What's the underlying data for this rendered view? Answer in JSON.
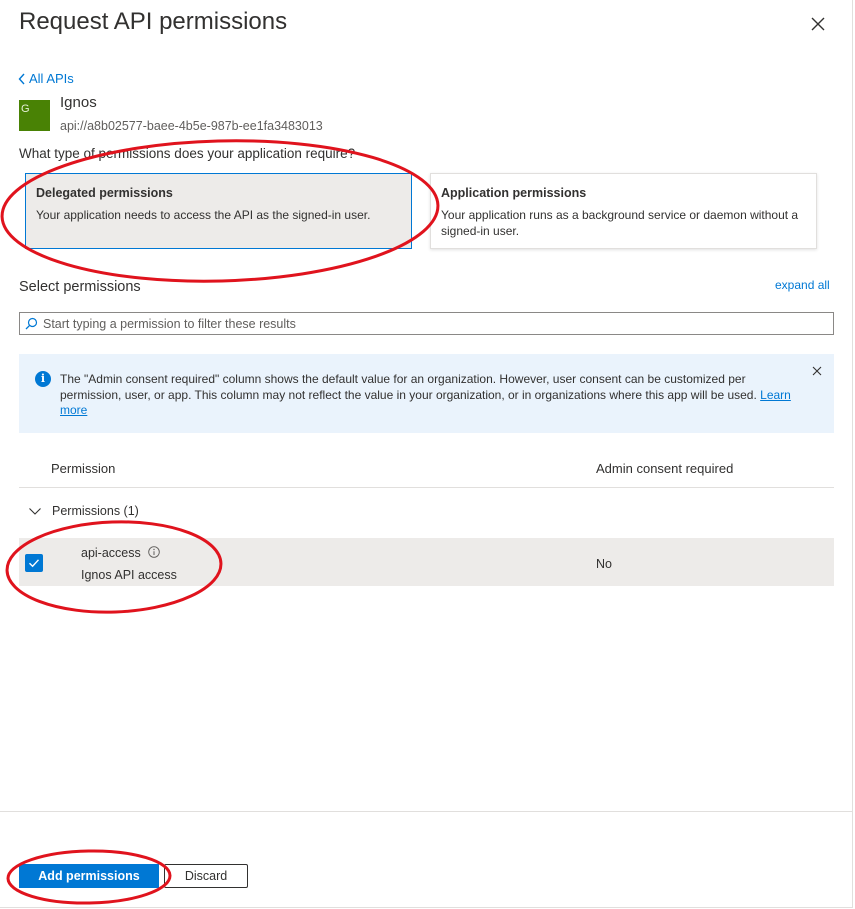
{
  "panel": {
    "title": "Request API permissions",
    "back_link": "All APIs"
  },
  "api": {
    "avatar_letter": "G",
    "avatar_color": "#498205",
    "name": "Ignos",
    "uri": "api://a8b02577-baee-4b5e-987b-ee1fa3483013"
  },
  "permission_types": {
    "question": "What type of permissions does your application require?",
    "delegated": {
      "title": "Delegated permissions",
      "description": "Your application needs to access the API as the signed-in user.",
      "selected": true
    },
    "application": {
      "title": "Application permissions",
      "description": "Your application runs as a background service or daemon without a signed-in user.",
      "selected": false
    }
  },
  "select_permissions": {
    "heading": "Select permissions",
    "expand_all": "expand all",
    "filter_placeholder": "Start typing a permission to filter these results"
  },
  "info_banner": {
    "text": "The \"Admin consent required\" column shows the default value for an organization. However, user consent can be customized per permission, user, or app. This column may not reflect the value in your organization, or in organizations where this app will be used.",
    "link": "Learn more"
  },
  "table": {
    "columns": [
      "Permission",
      "Admin consent required"
    ],
    "group": {
      "label": "Permissions (1)",
      "expanded": true
    },
    "rows": [
      {
        "name": "api-access",
        "description": "Ignos API access",
        "admin_consent": "No",
        "checked": true
      }
    ]
  },
  "footer": {
    "primary_button": "Add permissions",
    "secondary_button": "Discard"
  },
  "colors": {
    "accent": "#0078d4",
    "annotation": "#e0131d",
    "info_background": "#eaf3fc"
  }
}
